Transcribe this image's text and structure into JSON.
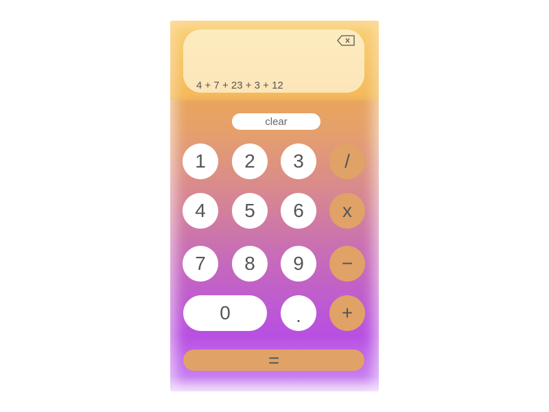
{
  "display": {
    "expression": "4 + 7 + 23 + 3 + 12",
    "backspace_icon": "backspace-icon"
  },
  "clear_label": "clear",
  "keys": {
    "k1": "1",
    "k2": "2",
    "k3": "3",
    "div": "/",
    "k4": "4",
    "k5": "5",
    "k6": "6",
    "mul": "x",
    "k7": "7",
    "k8": "8",
    "k9": "9",
    "sub": "−",
    "k0": "0",
    "dot": ".",
    "add": "+",
    "eq": "="
  },
  "colors": {
    "operator": "#e0a266",
    "digit": "#ffffff"
  }
}
